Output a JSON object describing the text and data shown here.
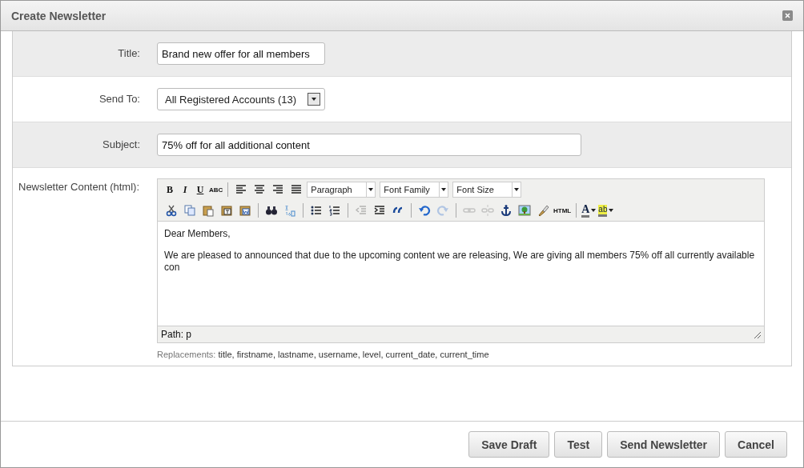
{
  "window": {
    "title": "Create Newsletter"
  },
  "form": {
    "rows": [
      {
        "kind": "text",
        "label": "Title:",
        "value": "Brand new offer for all members",
        "shaded": true
      },
      {
        "kind": "select",
        "label": "Send To:",
        "value": "All Registered Accounts (13)",
        "shaded": false
      },
      {
        "kind": "text_wide",
        "label": "Subject:",
        "value": "75% off for all additional content",
        "shaded": true
      }
    ]
  },
  "content": {
    "label": "Newsletter Content (html):",
    "toolbar": [
      [
        {
          "kind": "text",
          "label": "B"
        },
        {
          "kind": "text",
          "label": "I"
        },
        {
          "kind": "text",
          "label": "U"
        },
        {
          "kind": "text",
          "label": "ABC"
        },
        {
          "kind": "sep"
        },
        {
          "kind": "icon",
          "disabled": false
        },
        {
          "kind": "icon",
          "disabled": false
        },
        {
          "kind": "icon",
          "disabled": false
        },
        {
          "kind": "icon",
          "disabled": false
        },
        {
          "kind": "select",
          "label": "Paragraph"
        },
        {
          "kind": "select",
          "label": "Font Family"
        },
        {
          "kind": "select",
          "label": "Font Size"
        }
      ],
      [
        {
          "kind": "icon",
          "disabled": false
        },
        {
          "kind": "icon",
          "disabled": false
        },
        {
          "kind": "icon",
          "disabled": false
        },
        {
          "kind": "icon",
          "disabled": false
        },
        {
          "kind": "icon",
          "disabled": false
        },
        {
          "kind": "sep"
        },
        {
          "kind": "icon",
          "disabled": false
        },
        {
          "kind": "icon",
          "disabled": false
        },
        {
          "kind": "sep"
        },
        {
          "kind": "icon",
          "disabled": false
        },
        {
          "kind": "icon",
          "disabled": false
        },
        {
          "kind": "sep"
        },
        {
          "kind": "icon",
          "disabled": true
        },
        {
          "kind": "icon",
          "disabled": false
        },
        {
          "kind": "icon",
          "disabled": false
        },
        {
          "kind": "sep"
        },
        {
          "kind": "icon",
          "disabled": false
        },
        {
          "kind": "icon",
          "disabled": true
        },
        {
          "kind": "sep"
        },
        {
          "kind": "icon",
          "disabled": true
        },
        {
          "kind": "icon",
          "disabled": true
        },
        {
          "kind": "icon",
          "disabled": false
        },
        {
          "kind": "icon",
          "disabled": false
        },
        {
          "kind": "icon",
          "disabled": false
        },
        {
          "kind": "text",
          "label": "HTML"
        },
        {
          "kind": "sep"
        },
        {
          "kind": "color",
          "label": "A"
        },
        {
          "kind": "color",
          "label": "ab"
        }
      ]
    ],
    "paragraphs": [
      "Dear Members,",
      "We are pleased to announced that due to the upcoming content we are releasing, We are giving all members 75% off all currently available con"
    ],
    "path": "Path: p",
    "replacements_label": "Replacements:",
    "replacements": "title, firstname, lastname, username, level, current_date, current_time"
  },
  "buttons": [
    "Save Draft",
    "Test",
    "Send Newsletter",
    "Cancel"
  ]
}
